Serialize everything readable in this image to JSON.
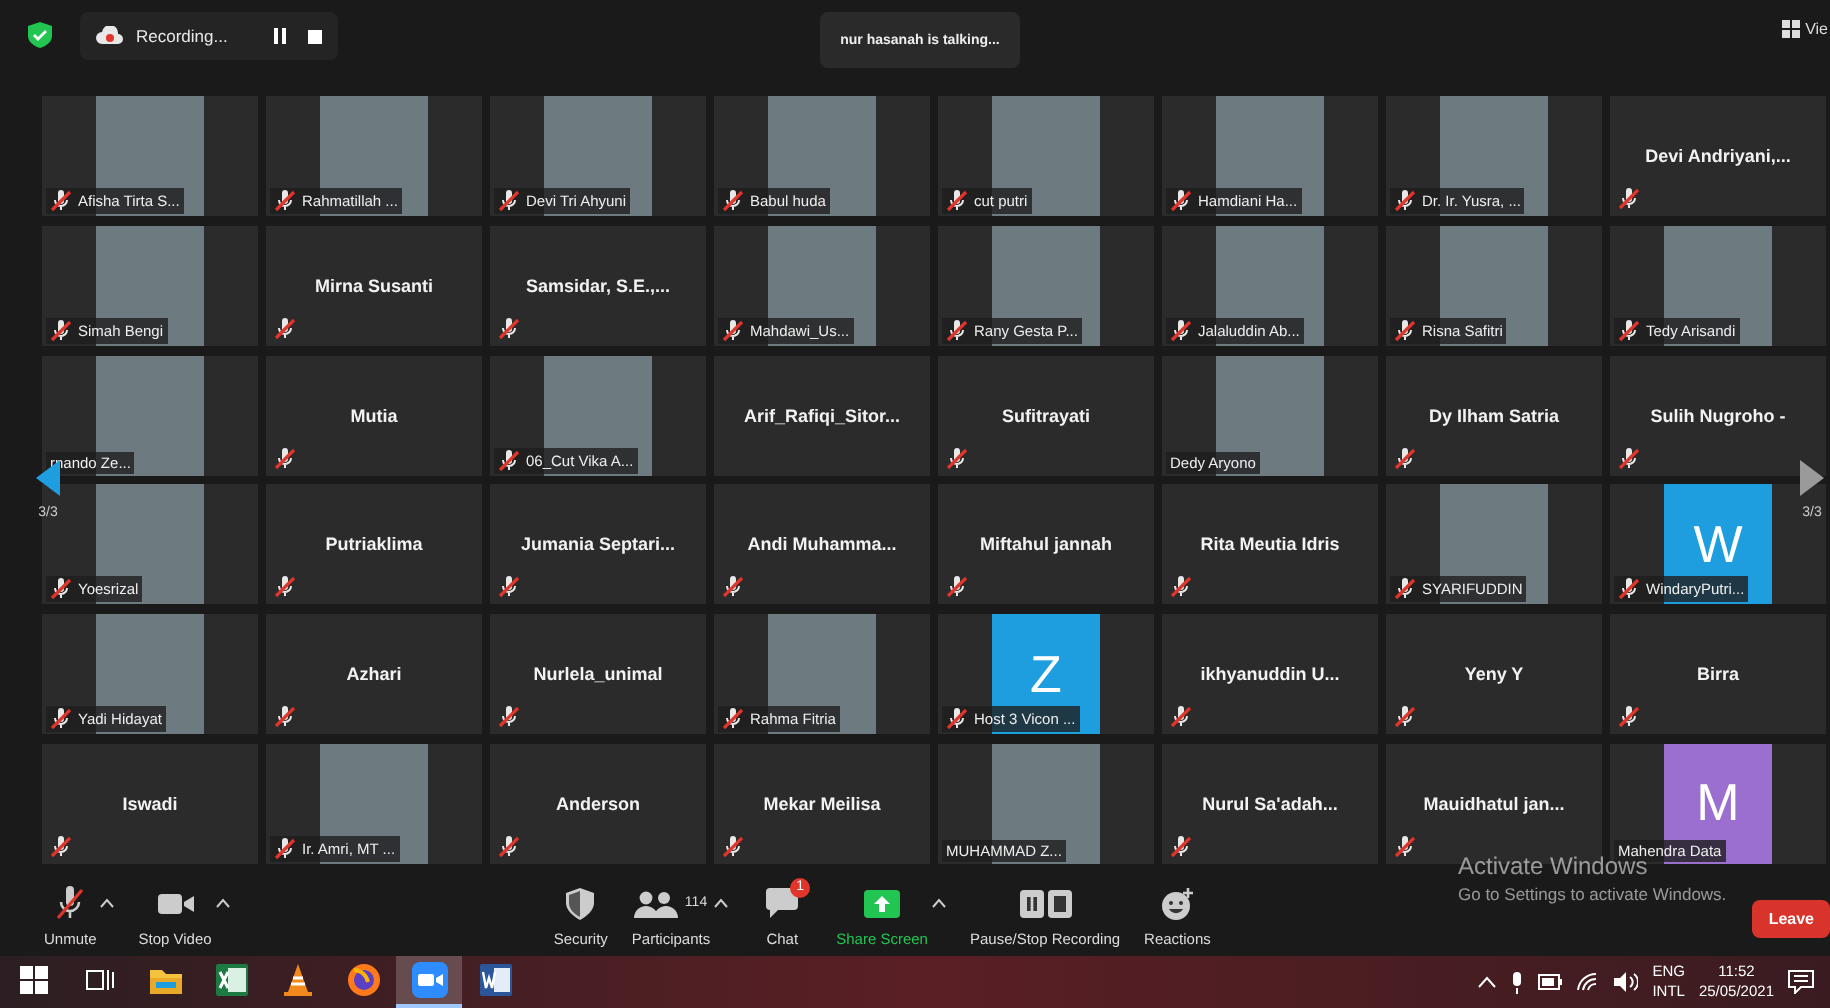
{
  "top_bar": {
    "recording": {
      "label": "Recording...",
      "paused": false
    },
    "talking": "nur hasanah is talking...",
    "view": "Vie"
  },
  "pager": {
    "left": "3/3",
    "right": "3/3"
  },
  "tiles": [
    {
      "kind": "photo",
      "name": "Afisha Tirta S...",
      "muted": true
    },
    {
      "kind": "photo",
      "name": "Rahmatillah ...",
      "muted": true
    },
    {
      "kind": "photo",
      "name": "Devi Tri Ahyuni",
      "muted": true
    },
    {
      "kind": "photo",
      "name": "Babul huda",
      "muted": true
    },
    {
      "kind": "photo",
      "name": "cut putri",
      "muted": true
    },
    {
      "kind": "photo",
      "name": "Hamdiani Ha...",
      "muted": true
    },
    {
      "kind": "photo",
      "name": "Dr. Ir. Yusra, ...",
      "muted": true
    },
    {
      "kind": "name",
      "name": "Devi  Andriyani,...",
      "muted": true
    },
    {
      "kind": "photo",
      "name": "Simah Bengi",
      "muted": true
    },
    {
      "kind": "name",
      "name": "Mirna Susanti",
      "muted": true
    },
    {
      "kind": "name",
      "name": "Samsidar,  S.E.,...",
      "muted": true
    },
    {
      "kind": "photo",
      "name": "Mahdawi_Us...",
      "muted": true
    },
    {
      "kind": "photo",
      "name": "Rany Gesta P...",
      "muted": true
    },
    {
      "kind": "photo",
      "name": "Jalaluddin Ab...",
      "muted": true
    },
    {
      "kind": "photo",
      "name": "Risna Safitri",
      "muted": true
    },
    {
      "kind": "photo",
      "name": "Tedy Arisandi",
      "muted": true
    },
    {
      "kind": "photo",
      "name": "rnando Ze...",
      "muted": false
    },
    {
      "kind": "name",
      "name": "Mutia",
      "muted": true
    },
    {
      "kind": "photo",
      "name": "06_Cut Vika A...",
      "muted": true
    },
    {
      "kind": "name",
      "name": "Arif_Rafiqi_Sitor...",
      "muted": false
    },
    {
      "kind": "name",
      "name": "Sufitrayati",
      "muted": true
    },
    {
      "kind": "photo",
      "name": "Dedy Aryono",
      "muted": false
    },
    {
      "kind": "name",
      "name": "Dy Ilham Satria",
      "muted": true
    },
    {
      "kind": "name",
      "name": "Sulih  Nugroho  -",
      "muted": true
    },
    {
      "kind": "photo",
      "name": "Yoesrizal",
      "muted": true
    },
    {
      "kind": "name",
      "name": "Putriaklima",
      "muted": true
    },
    {
      "kind": "name",
      "name": "Jumania  Septari...",
      "muted": true
    },
    {
      "kind": "name",
      "name": "Andi  Muhamma...",
      "muted": true
    },
    {
      "kind": "name",
      "name": "Miftahul jannah",
      "muted": true
    },
    {
      "kind": "name",
      "name": "Rita Meutia Idris",
      "muted": true
    },
    {
      "kind": "photo",
      "name": "SYARIFUDDIN",
      "muted": true
    },
    {
      "kind": "letter",
      "letter": "W",
      "color": "#1e9ede",
      "name": "WindaryPutri...",
      "muted": true
    },
    {
      "kind": "photo",
      "name": "Yadi Hidayat",
      "muted": true
    },
    {
      "kind": "name",
      "name": "Azhari",
      "muted": true
    },
    {
      "kind": "name",
      "name": "Nurlela_unimal",
      "muted": true
    },
    {
      "kind": "photo",
      "name": "Rahma Fitria",
      "muted": true
    },
    {
      "kind": "letter",
      "letter": "Z",
      "color": "#1e9ede",
      "name": "Host 3 Vicon ...",
      "muted": true
    },
    {
      "kind": "name",
      "name": "ikhyanuddin   U...",
      "muted": true
    },
    {
      "kind": "name",
      "name": "Yeny Y",
      "muted": true
    },
    {
      "kind": "name",
      "name": "Birra",
      "muted": true
    },
    {
      "kind": "name",
      "name": "Iswadi",
      "muted": true
    },
    {
      "kind": "photo",
      "name": "Ir. Amri, MT ...",
      "muted": true
    },
    {
      "kind": "name",
      "name": "Anderson",
      "muted": true
    },
    {
      "kind": "name",
      "name": "Mekar Meilisa",
      "muted": true
    },
    {
      "kind": "photo",
      "name": "MUHAMMAD Z...",
      "muted": false
    },
    {
      "kind": "name",
      "name": "Nurul  Sa'adah...",
      "muted": true
    },
    {
      "kind": "name",
      "name": "Mauidhatul  jan...",
      "muted": true
    },
    {
      "kind": "letter",
      "letter": "M",
      "color": "#9b6fd0",
      "name": "Mahendra Data",
      "muted": false
    }
  ],
  "toolbar": [
    {
      "kind": "mic",
      "label": "Unmute",
      "caret": true
    },
    {
      "kind": "video",
      "label": "Stop Video",
      "caret": true
    },
    {
      "kind": "spacer"
    },
    {
      "kind": "security",
      "label": "Security",
      "caret": false
    },
    {
      "kind": "participants",
      "label": "Participants",
      "count": "114",
      "caret": true
    },
    {
      "kind": "chat",
      "label": "Chat",
      "badge": "1",
      "caret": false
    },
    {
      "kind": "share",
      "label": "Share Screen",
      "caret": true
    },
    {
      "kind": "recording",
      "label": "Pause/Stop Recording",
      "caret": false
    },
    {
      "kind": "reactions",
      "label": "Reactions",
      "caret": false
    }
  ],
  "leave": "Leave",
  "activation": {
    "title": "Activate Windows",
    "subtitle": "Go to Settings to activate Windows."
  },
  "taskbar": {
    "apps": [
      {
        "kind": "start",
        "active": false
      },
      {
        "kind": "taskview",
        "active": false
      },
      {
        "kind": "folder",
        "active": false
      },
      {
        "kind": "sheet",
        "active": false
      },
      {
        "kind": "cone",
        "active": false
      },
      {
        "kind": "browser",
        "active": false
      },
      {
        "kind": "camera",
        "active": true
      },
      {
        "kind": "doc",
        "active": false
      }
    ],
    "language": [
      "ENG",
      "INTL"
    ],
    "time": "11:52",
    "date": "25/05/2021"
  }
}
